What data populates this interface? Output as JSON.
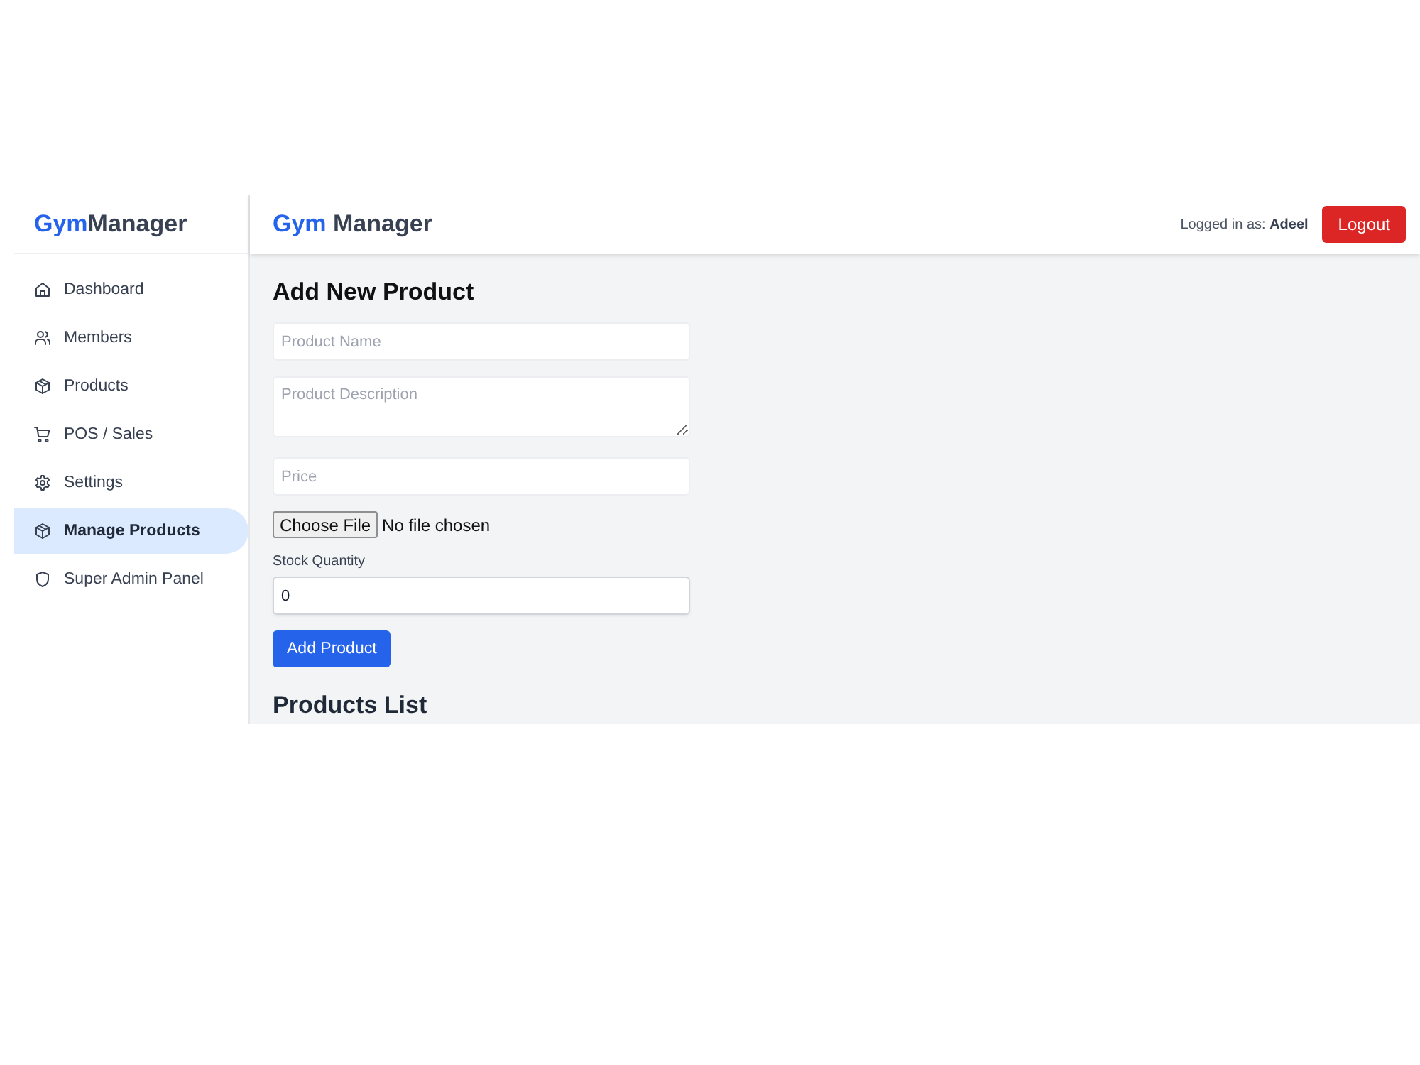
{
  "sidebar": {
    "brand": {
      "accent": "Gym",
      "rest": "Manager"
    },
    "items": [
      {
        "label": "Dashboard",
        "selected": false
      },
      {
        "label": "Members",
        "selected": false
      },
      {
        "label": "Products",
        "selected": false
      },
      {
        "label": "POS / Sales",
        "selected": false
      },
      {
        "label": "Settings",
        "selected": false
      },
      {
        "label": "Manage Products",
        "selected": true
      },
      {
        "label": "Super Admin Panel",
        "selected": false
      }
    ]
  },
  "header": {
    "title": {
      "accent": "Gym",
      "rest": "Manager"
    },
    "user": "Logged in as: **Adeel**",
    "logout_button": "Logout"
  },
  "main": {
    "form_title": "Add New Product",
    "fields": [
      {
        "kind": "text",
        "placeholder": "Product Name"
      },
      {
        "kind": "textarea",
        "placeholder": "Product Description"
      },
      {
        "kind": "text",
        "placeholder": "Price"
      },
      {
        "kind": "file",
        "button": "Choose File",
        "status": "No file chosen"
      },
      {
        "kind": "number",
        "label": "Stock Quantity",
        "value": "0"
      }
    ],
    "submit_button": "Add Product",
    "list_title": "Products List"
  }
}
